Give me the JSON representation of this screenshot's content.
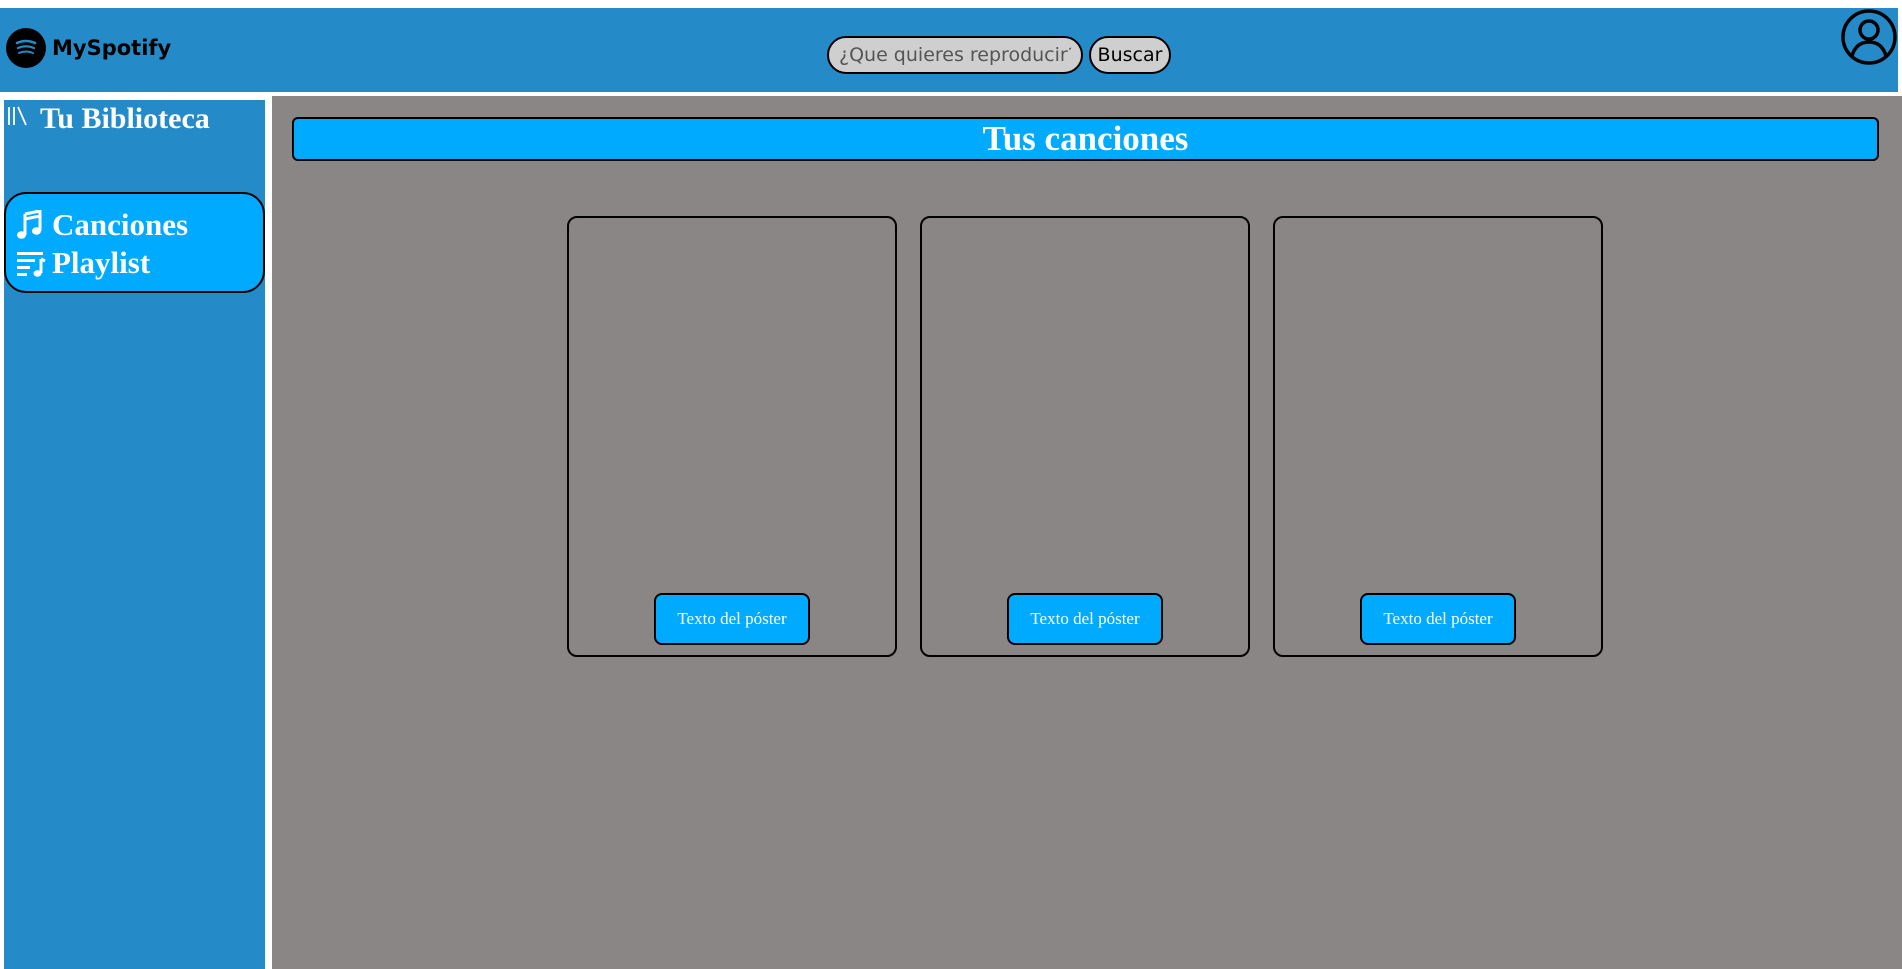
{
  "header": {
    "logo_text": "MySpotify",
    "search_placeholder": "¿Que quieres reproducir?",
    "search_button": "Buscar"
  },
  "sidebar": {
    "title": "Tu Biblioteca",
    "items": [
      {
        "label": "Canciones",
        "icon": "music-note-icon"
      },
      {
        "label": "Playlist",
        "icon": "playlist-icon"
      }
    ]
  },
  "main": {
    "title": "Tus canciones",
    "cards": [
      {
        "button": "Texto del póster"
      },
      {
        "button": "Texto del póster"
      },
      {
        "button": "Texto del póster"
      }
    ]
  },
  "colors": {
    "header_bg": "#248bc8",
    "accent": "#00aaff",
    "content_bg": "#8a8685"
  }
}
